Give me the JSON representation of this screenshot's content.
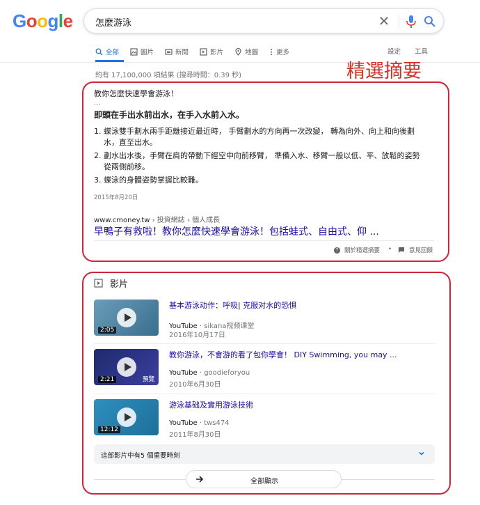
{
  "header": {
    "logo": "Google",
    "logo_colors": [
      "#4285F4",
      "#EA4335",
      "#FBBC05",
      "#4285F4",
      "#34A853",
      "#EA4335"
    ],
    "query": "怎麼游泳"
  },
  "tabs": [
    {
      "label": "全部",
      "icon": "search-icon",
      "active": true
    },
    {
      "label": "圖片",
      "icon": "image-icon"
    },
    {
      "label": "新聞",
      "icon": "news-icon"
    },
    {
      "label": "影片",
      "icon": "video-icon"
    },
    {
      "label": "地圖",
      "icon": "map-pin-icon"
    },
    {
      "label": "更多",
      "icon": "more-vert-icon"
    }
  ],
  "tools": {
    "settings": "設定",
    "tools": "工具"
  },
  "stats": "約有 17,100,000 項結果 (搜尋時間：0.39 秒)",
  "annotation": "精選摘要",
  "snippet": {
    "question": "教你怎麼快速學會游泳！",
    "ellipsis": "...",
    "answer": "即頭在手出水前出水，在手入水前入水。",
    "list": [
      {
        "num": "1.",
        "text": "蝶泳雙手劃水兩手距離接近最近時， 手臂劃水的方向再一次改變， 轉為向外、向上和向後劃水，直至出水。"
      },
      {
        "num": "2.",
        "text": "劃水出水後，手臂在肩的帶動下經空中向前移臂， 準備入水、移臂一般以低、平、放鬆的姿勢 從兩側前移。"
      },
      {
        "num": "3.",
        "text": "蝶泳的身體姿勢掌握比較難。"
      }
    ],
    "date": "2015年8月20日",
    "site": "www.cmoney.tw",
    "breadcrumb": " › 投資網誌 › 個人成長",
    "link": "早鴨子有救啦！教你怎麼快速學會游泳！包括蛙式、自由式、仰 ...",
    "about": "關於精選摘要",
    "feedback": "意見回饋"
  },
  "videos": {
    "heading": "影片",
    "items": [
      {
        "title": "基本游泳动作：呼吸| 克服对水的恐惧",
        "source": "YouTube",
        "channel": " · sikana视频课堂",
        "date": "2016年10月17日",
        "duration": "2:05",
        "tag": "",
        "thumb_colors": [
          "#6a9db8",
          "#3a6e8e"
        ]
      },
      {
        "title": "教你游泳，不會游的看了包你學會！ DIY Swimming, you may ...",
        "source": "YouTube",
        "channel": " · goodieforyou",
        "date": "2010年6月30日",
        "duration": "2:21",
        "tag": "預覽",
        "thumb_colors": [
          "#1e2a6e",
          "#3b3f9e"
        ]
      },
      {
        "title": "游泳基础及實用游泳技術",
        "source": "YouTube",
        "channel": " · tws474",
        "date": "2011年8月30日",
        "duration": "12:12",
        "tag": "",
        "thumb_colors": [
          "#2f8fbf",
          "#1d6f9a"
        ]
      }
    ],
    "key_moments": "這部影片中有5 個重要時刻",
    "show_all": "全部顯示"
  }
}
